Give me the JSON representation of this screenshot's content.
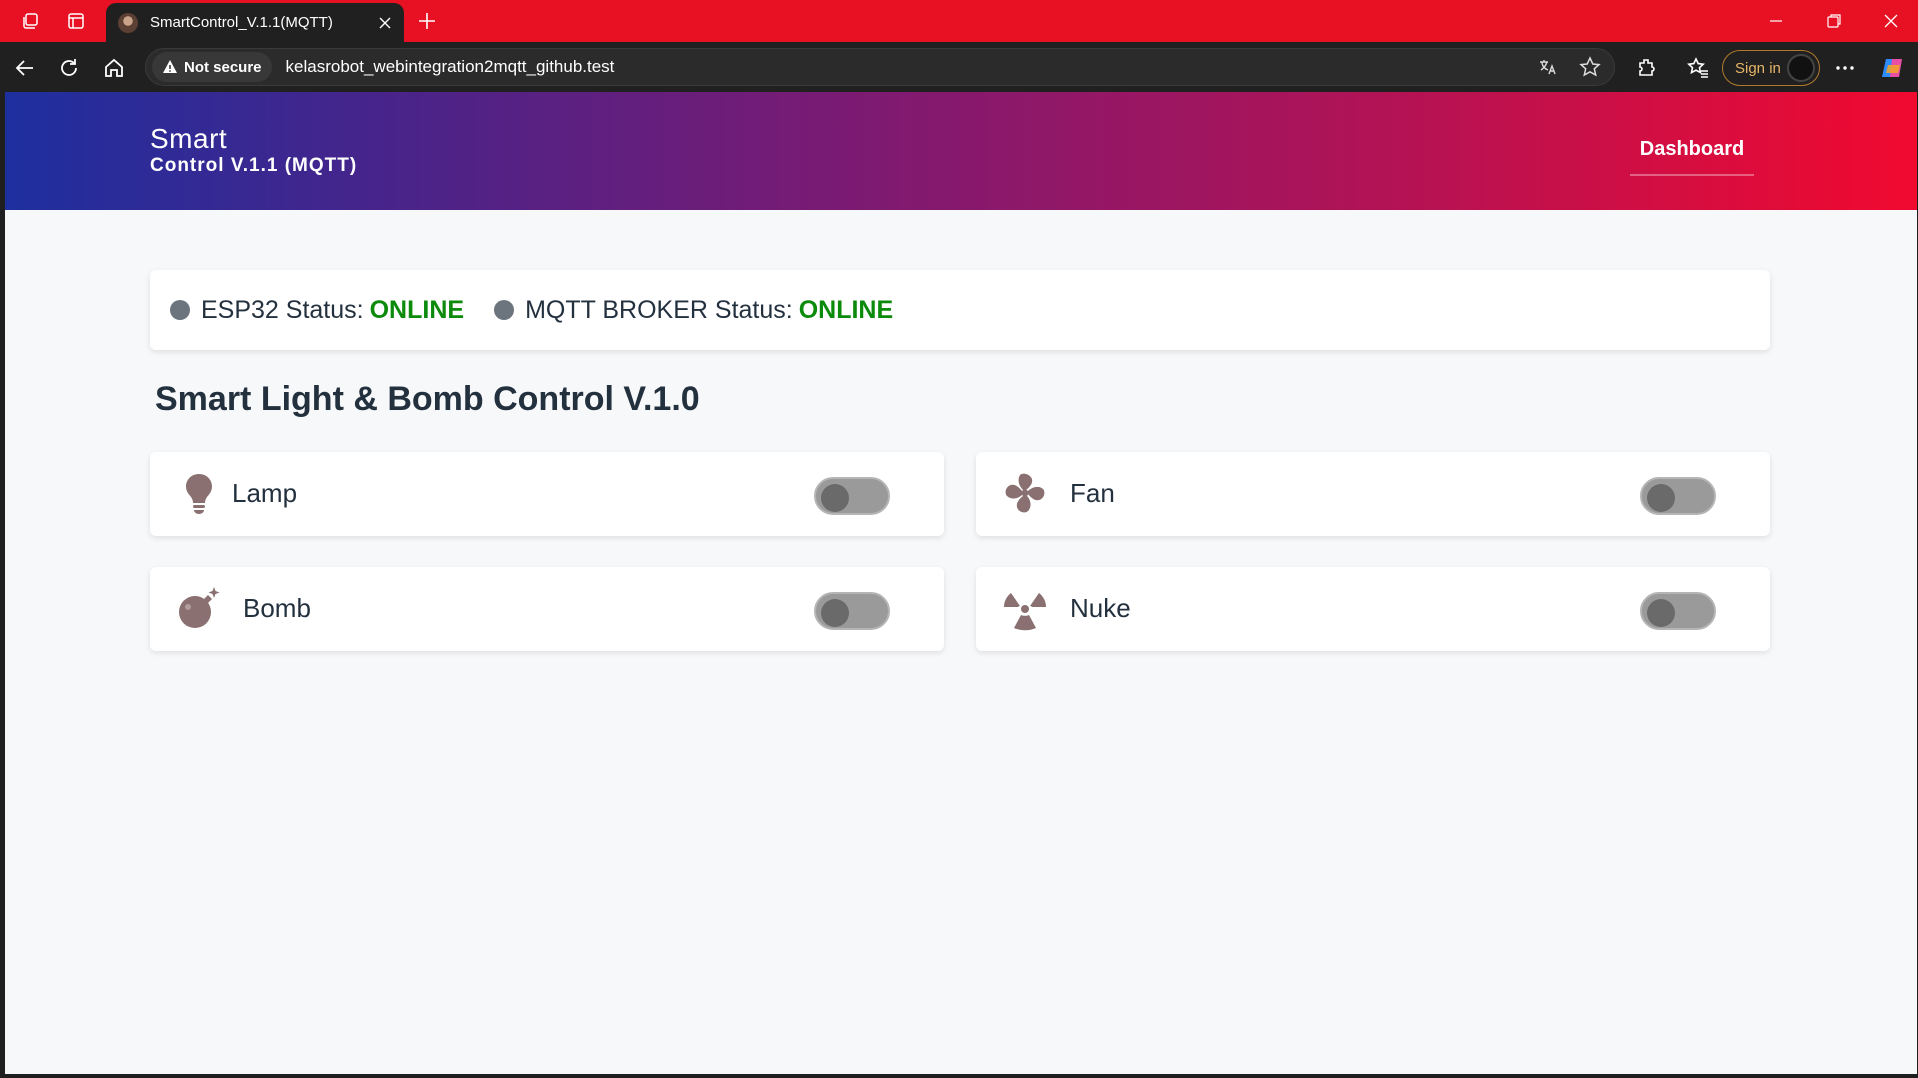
{
  "browser": {
    "tab_title": "SmartControl_V.1.1(MQTT)",
    "security_label": "Not secure",
    "url": "kelasrobot_webintegration2mqtt_github.test",
    "sign_in_label": "Sign in"
  },
  "header": {
    "brand_line1": "Smart",
    "brand_line2": "Control V.1.1 (MQTT)",
    "nav_dashboard": "Dashboard"
  },
  "status": {
    "esp32_label": "ESP32 Status:",
    "esp32_value": "ONLINE",
    "mqtt_label": "MQTT BROKER Status:",
    "mqtt_value": "ONLINE"
  },
  "section_title": "Smart Light & Bomb Control V.1.0",
  "devices": [
    {
      "label": "Lamp",
      "icon": "lightbulb-icon",
      "on": false
    },
    {
      "label": "Fan",
      "icon": "fan-icon",
      "on": false
    },
    {
      "label": "Bomb",
      "icon": "bomb-icon",
      "on": false
    },
    {
      "label": "Nuke",
      "icon": "radiation-icon",
      "on": false
    }
  ],
  "colors": {
    "accent_start": "#1e2f9f",
    "accent_end": "#f1092f",
    "online": "#0b8a0b",
    "icon": "#8a7070"
  }
}
